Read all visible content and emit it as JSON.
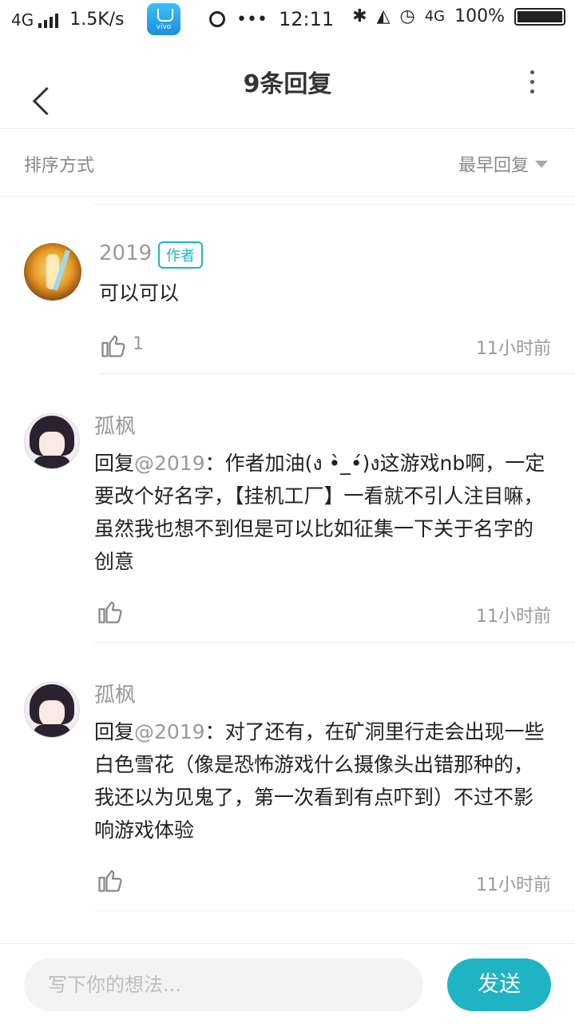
{
  "status_bar": {
    "network": "4G",
    "speed": "1.5K/s",
    "app_icon_label": "vivo",
    "dots": "•••",
    "time": "12:11",
    "network_right": "4G",
    "battery": "100%"
  },
  "header": {
    "title": "9条回复"
  },
  "sort": {
    "label": "排序方式",
    "value": "最早回复"
  },
  "comments": [
    {
      "name": "2019",
      "badge": "作者",
      "prefix": "",
      "mention": "",
      "text": "可以可以",
      "likes": "1",
      "time": "11小时前"
    },
    {
      "name": "孤枫",
      "badge": "",
      "prefix": "回复",
      "mention": "@2019",
      "text": "：作者加油(ง •̀_•́)ง这游戏nb啊，一定要改个好名字，【挂机工厂】一看就不引人注目嘛，虽然我也想不到但是可以比如征集一下关于名字的创意",
      "likes": "",
      "time": "11小时前"
    },
    {
      "name": "孤枫",
      "badge": "",
      "prefix": "回复",
      "mention": "@2019",
      "text": "：对了还有，在矿洞里行走会出现一些白色雪花（像是恐怖游戏什么摄像头出错那种的，我还以为见鬼了，第一次看到有点吓到）不过不影响游戏体验",
      "likes": "",
      "time": "11小时前"
    }
  ],
  "composer": {
    "placeholder": "写下你的想法...",
    "send_label": "发送"
  },
  "colors": {
    "accent": "#1fb4c3",
    "muted_text": "#999999"
  }
}
